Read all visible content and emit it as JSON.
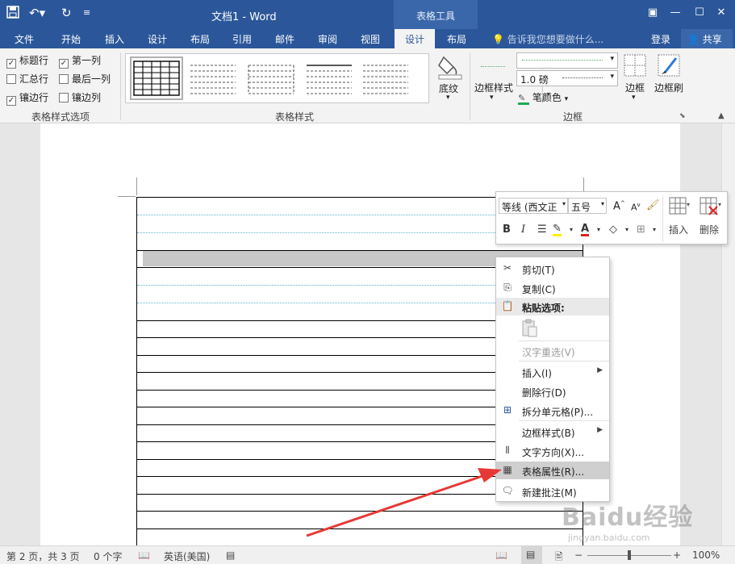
{
  "titlebar": {
    "save_icon": "save-icon",
    "undo_icon": "undo-icon",
    "redo_icon": "redo-icon",
    "title": "文档1 - Word",
    "contextual_tab": "表格工具"
  },
  "tabs": [
    "文件",
    "开始",
    "插入",
    "设计",
    "布局",
    "引用",
    "邮件",
    "审阅",
    "视图",
    "设计",
    "布局"
  ],
  "active_tab": "设计",
  "tell_me": "告诉我您想要做什么...",
  "login": "登录",
  "share": "共享",
  "ribbon": {
    "style_options": {
      "header_row": "标题行",
      "first_column": "第一列",
      "total_row": "汇总行",
      "last_column": "最后一列",
      "banded_rows": "镶边行",
      "banded_columns": "镶边列",
      "group_label": "表格样式选项",
      "checked": {
        "header_row": true,
        "first_column": true,
        "total_row": false,
        "last_column": false,
        "banded_rows": true,
        "banded_columns": false
      }
    },
    "table_styles_label": "表格样式",
    "shading": "底纹",
    "border_styles": "边框样式",
    "pen_weight": "1.0 磅",
    "pen_color": "笔颜色",
    "borders": "边框",
    "border_painter": "边框刷",
    "borders_group_label": "边框"
  },
  "mini_toolbar": {
    "font": "等线 (西文正",
    "size": "五号",
    "bold": "B",
    "italic": "I",
    "insert": "插入",
    "delete": "删除"
  },
  "context_menu": {
    "cut": "剪切(T)",
    "copy": "复制(C)",
    "paste_options": "粘贴选项:",
    "reconvert": "汉字重选(V)",
    "insert": "插入(I)",
    "delete_rows": "删除行(D)",
    "split_cells": "拆分单元格(P)...",
    "border_styles": "边框样式(B)",
    "text_direction": "文字方向(X)...",
    "table_properties": "表格属性(R)...",
    "new_comment": "新建批注(M)"
  },
  "statusbar": {
    "page": "第 2 页，共 3 页",
    "words": "0 个字",
    "language": "英语(美国)",
    "zoom": "100%"
  },
  "watermark": {
    "logo": "Baidu经验",
    "url": "jingyan.baidu.com"
  },
  "colors": {
    "title_blue": "#2b579a",
    "arrow_red": "#e53935"
  }
}
